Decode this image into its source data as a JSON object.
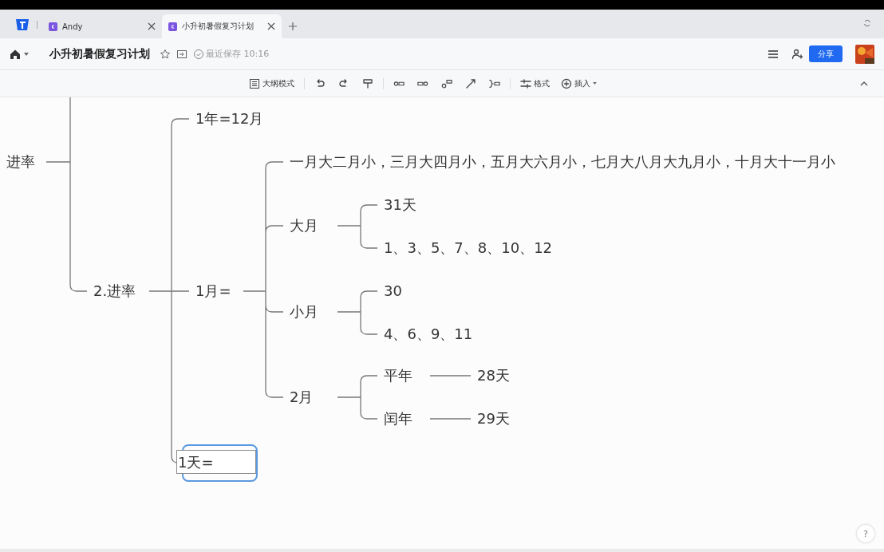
{
  "tabs": [
    {
      "label": "Andy",
      "selected": false
    },
    {
      "label": "小升初暑假复习计划",
      "selected": true
    }
  ],
  "document": {
    "title": "小升初暑假复习计划",
    "save_status": "最近保存 10:16"
  },
  "share_button": "分享",
  "toolbar": {
    "outline_mode": "大纲模式",
    "format": "格式",
    "insert": "插入"
  },
  "mindmap": {
    "text": "进率",
    "children": [
      {
        "text": "2.进率",
        "children": [
          {
            "text": "1年=12月"
          },
          {
            "text": "1月=",
            "children": [
              {
                "text": "一月大二月小，三月大四月小，五月大六月小，七月大八月大九月小，十月大十一月小"
              },
              {
                "text": "大月",
                "children": [
                  {
                    "text": "31天"
                  },
                  {
                    "text": "1、3、5、7、8、10、12"
                  }
                ]
              },
              {
                "text": "小月",
                "children": [
                  {
                    "text": "30"
                  },
                  {
                    "text": "4、6、9、11"
                  }
                ]
              },
              {
                "text": "2月",
                "children": [
                  {
                    "text": "平年",
                    "children": [
                      {
                        "text": "28天"
                      }
                    ]
                  },
                  {
                    "text": "闰年",
                    "children": [
                      {
                        "text": "29天"
                      }
                    ]
                  }
                ]
              }
            ]
          },
          {
            "text": "1天=",
            "editing": true
          }
        ]
      }
    ]
  },
  "help_button": "?"
}
